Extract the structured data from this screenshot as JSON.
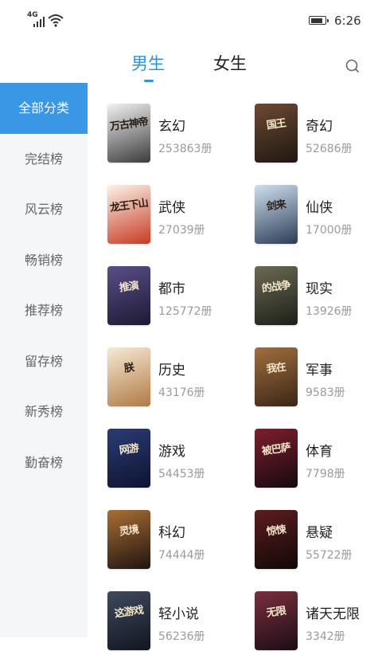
{
  "status": {
    "network": "4G",
    "time": "6:26",
    "battery_level": 0.9
  },
  "tabs": [
    {
      "label": "男生",
      "active": true
    },
    {
      "label": "女生",
      "active": false
    }
  ],
  "sidebar": {
    "items": [
      {
        "label": "全部分类",
        "active": true
      },
      {
        "label": "完结榜",
        "active": false
      },
      {
        "label": "风云榜",
        "active": false
      },
      {
        "label": "畅销榜",
        "active": false
      },
      {
        "label": "推荐榜",
        "active": false
      },
      {
        "label": "留存榜",
        "active": false
      },
      {
        "label": "新秀榜",
        "active": false
      },
      {
        "label": "勤奋榜",
        "active": false
      }
    ]
  },
  "categories": [
    {
      "name": "玄幻",
      "count": "253863册",
      "cover_title": "万古神帝",
      "cover_colors": [
        "#f2f2f2",
        "#3b3b3b"
      ]
    },
    {
      "name": "奇幻",
      "count": "52686册",
      "cover_title": "国王",
      "cover_colors": [
        "#6d4a33",
        "#1f1712"
      ]
    },
    {
      "name": "武侠",
      "count": "27039册",
      "cover_title": "龙王下山",
      "cover_colors": [
        "#fbf4ea",
        "#c83a22"
      ]
    },
    {
      "name": "仙侠",
      "count": "17000册",
      "cover_title": "剑来",
      "cover_colors": [
        "#cfe0ef",
        "#2d3c56"
      ]
    },
    {
      "name": "都市",
      "count": "125772册",
      "cover_title": "推演",
      "cover_colors": [
        "#5a4e8a",
        "#1c1a33"
      ]
    },
    {
      "name": "现实",
      "count": "13926册",
      "cover_title": "的战争",
      "cover_colors": [
        "#6b6b53",
        "#1d1f1a"
      ]
    },
    {
      "name": "历史",
      "count": "43176册",
      "cover_title": "朕",
      "cover_colors": [
        "#f6ead5",
        "#b17a45"
      ]
    },
    {
      "name": "军事",
      "count": "9583册",
      "cover_title": "我在",
      "cover_colors": [
        "#a06f3e",
        "#3b2616"
      ]
    },
    {
      "name": "游戏",
      "count": "54453册",
      "cover_title": "网游",
      "cover_colors": [
        "#2b3c74",
        "#0e1430"
      ]
    },
    {
      "name": "体育",
      "count": "7798册",
      "cover_title": "被巴萨",
      "cover_colors": [
        "#7d1f2a",
        "#160910"
      ]
    },
    {
      "name": "科幻",
      "count": "74444册",
      "cover_title": "灵境",
      "cover_colors": [
        "#aa6f33",
        "#1e1410"
      ]
    },
    {
      "name": "悬疑",
      "count": "55722册",
      "cover_title": "惊悚",
      "cover_colors": [
        "#5c1d1d",
        "#100808"
      ]
    },
    {
      "name": "轻小说",
      "count": "56236册",
      "cover_title": "这游戏",
      "cover_colors": [
        "#3f4a5e",
        "#111520"
      ]
    },
    {
      "name": "诸天无限",
      "count": "3342册",
      "cover_title": "无限",
      "cover_colors": [
        "#7a2f3d",
        "#1b0d16"
      ]
    }
  ]
}
